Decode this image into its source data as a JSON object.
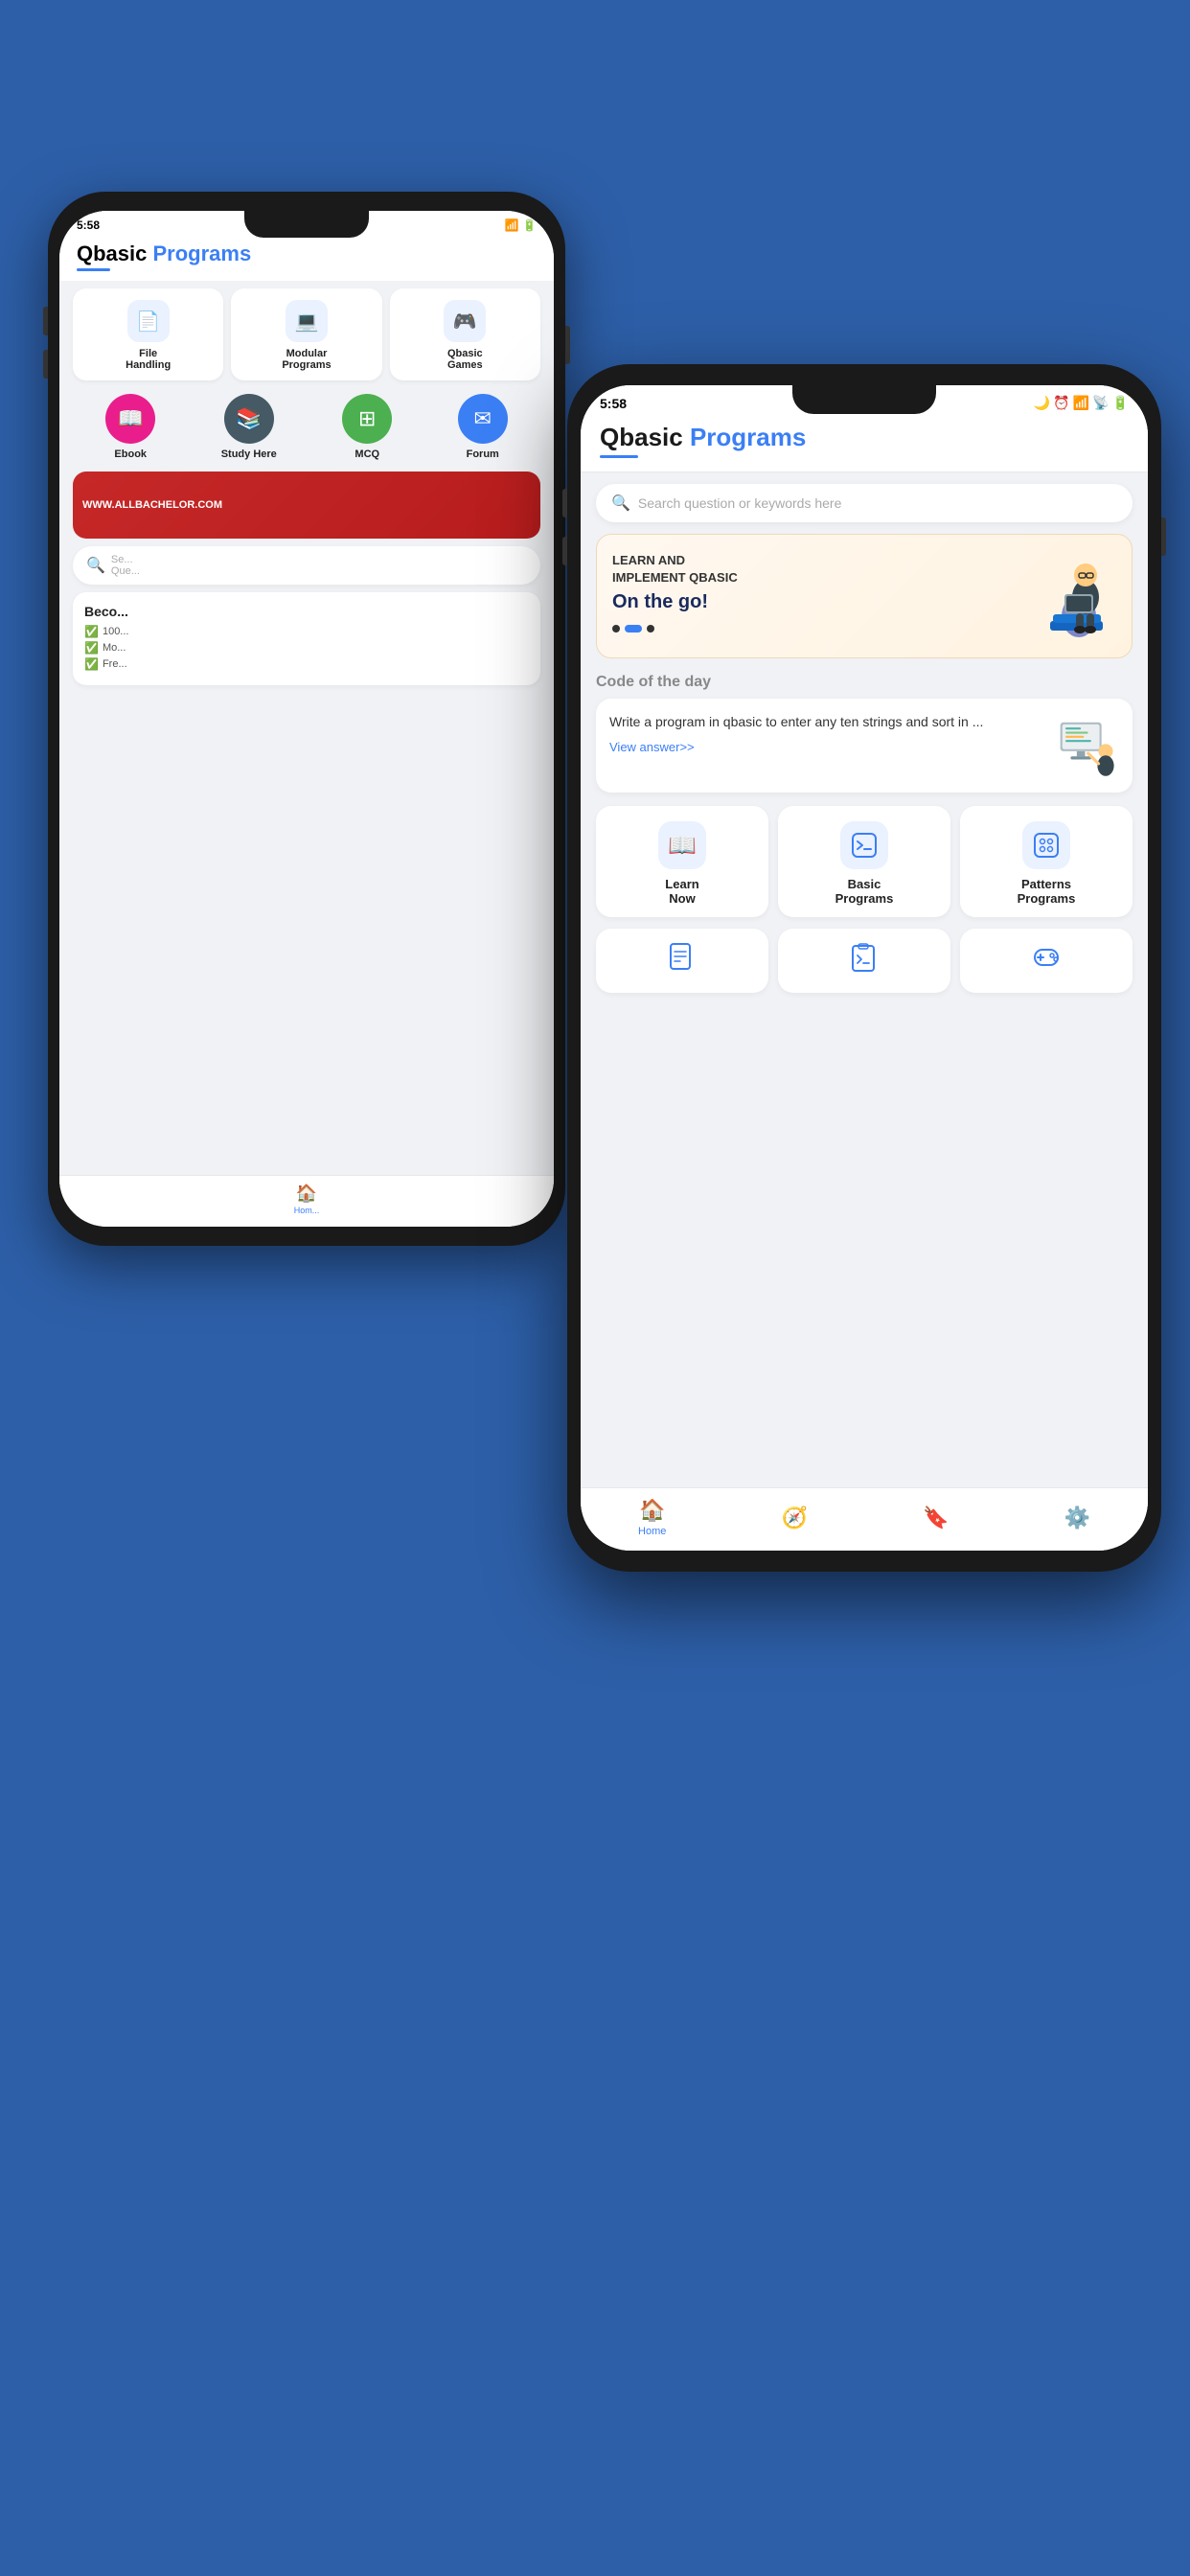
{
  "background_color": "#2d5fa8",
  "back_phone": {
    "status_time": "5:58",
    "app_title_black": "Qbasic",
    "app_title_blue": " Programs",
    "grid_items": [
      {
        "icon": "📄",
        "label": "File\nHandling"
      },
      {
        "icon": "💻",
        "label": "Modular\nPrograms"
      },
      {
        "icon": "🎮",
        "label": "Qbasic\nGames"
      }
    ],
    "circle_items": [
      {
        "color": "red",
        "icon": "📖",
        "label": "Ebook"
      },
      {
        "color": "dark",
        "icon": "📚",
        "label": "Study Here"
      },
      {
        "color": "green",
        "icon": "⊞",
        "label": "MCQ"
      },
      {
        "color": "blue",
        "icon": "✉",
        "label": "Forum"
      }
    ],
    "search_label": "Se...\nQue...",
    "become_title": "Beco...",
    "become_items": [
      "100...",
      "Mo...",
      "Fre..."
    ],
    "nav_label": "Hom..."
  },
  "front_phone": {
    "status_time": "5:58",
    "app_title_black": "Qbasic",
    "app_title_blue": " Programs",
    "search_placeholder": "Search question or keywords here",
    "banner": {
      "line1": "LEARN AND",
      "line2": "IMPLEMENT QBASIC",
      "line3": "On the go!",
      "dots": [
        false,
        true,
        false
      ]
    },
    "code_section_title": "Code of the day",
    "code_card": {
      "text": "Write a program in qbasic to enter any ten strings and sort in ...",
      "link_label": "View answer>>"
    },
    "grid_items": [
      {
        "icon": "📖",
        "label": "Learn\nNow"
      },
      {
        "icon": "💻",
        "label": "Basic\nPrograms"
      },
      {
        "icon": "🔀",
        "label": "Patterns\nPrograms"
      }
    ],
    "bottom_row_items": [
      {
        "icon": "📄"
      },
      {
        "icon": "💻"
      },
      {
        "icon": "🎮"
      }
    ],
    "nav_items": [
      {
        "icon": "🏠",
        "label": "Home",
        "active": true
      },
      {
        "icon": "🧭",
        "label": "",
        "active": false
      },
      {
        "icon": "🔖",
        "label": "",
        "active": false
      },
      {
        "icon": "⚙",
        "label": "",
        "active": false
      }
    ]
  }
}
